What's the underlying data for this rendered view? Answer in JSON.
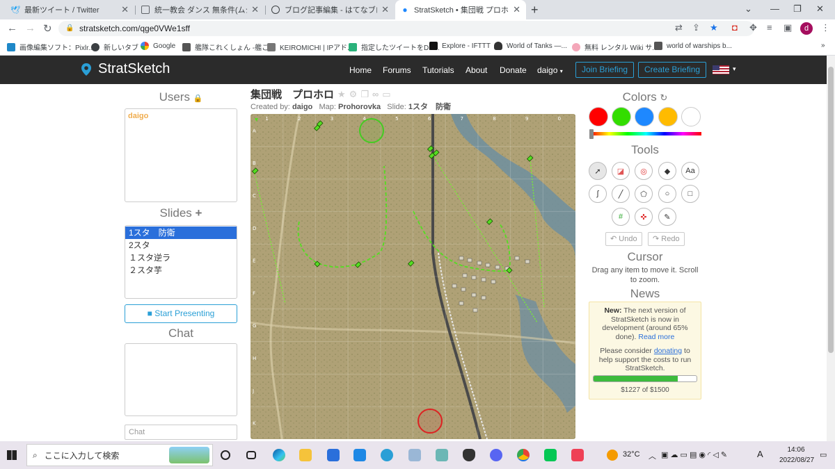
{
  "browser": {
    "tabs": [
      {
        "title": "最新ツイート / Twitter",
        "icon": "twitter-icon"
      },
      {
        "title": "統一教会 ダンス 無条件(ムジョ",
        "icon": "video-icon"
      },
      {
        "title": "ブログ記事編集 - はてなブログ",
        "icon": "hatena-icon"
      },
      {
        "title": "StratSketch • 集団戦 プロホロ",
        "icon": "stratsketch-pin-icon"
      }
    ],
    "url": "stratsketch.com/qge0VWe1sff",
    "bookmarks": [
      "画像編集ソフト：Pixlr...",
      "新しいタブ",
      "Google",
      "艦隊これくしょん -艦こ...",
      "KEIROMICHI | IPアド...",
      "指定したツイートをDis...",
      "Explore - IFTTT",
      "World of Tanks —...",
      "無料 レンタル Wiki サ...",
      "world of warships b..."
    ],
    "profile_initial": "d"
  },
  "site": {
    "brand": "StratSketch",
    "nav": [
      "Home",
      "Forums",
      "Tutorials",
      "About",
      "Donate"
    ],
    "user_menu": "daigo",
    "join_briefing": "Join Briefing",
    "create_briefing": "Create Briefing"
  },
  "users": {
    "heading": "Users",
    "list": [
      "daigo"
    ]
  },
  "slides": {
    "heading": "Slides",
    "items": [
      "1スタ　防衛",
      "2スタ",
      "１スタ逆ラ",
      "２スタ芋"
    ],
    "active_index": 0,
    "present_button": "Start Presenting"
  },
  "chat": {
    "heading": "Chat",
    "placeholder": "Chat"
  },
  "briefing": {
    "title": "集団戦　プロホロ",
    "created_by_label": "Created by:",
    "created_by": "daigo",
    "map_label": "Map:",
    "map": "Prohorovka",
    "slide_label": "Slide:",
    "slide": "1スタ　防衛"
  },
  "map": {
    "columns": [
      "1",
      "2",
      "3",
      "4",
      "5",
      "6",
      "7",
      "8",
      "9",
      "0"
    ],
    "rows": [
      "A",
      "B",
      "C",
      "D",
      "E",
      "F",
      "G",
      "H",
      "J",
      "K"
    ]
  },
  "colors": {
    "heading": "Colors",
    "swatches": [
      "#ff0000",
      "#33dd00",
      "#1e88ff",
      "#ffbb00",
      "#ffffff"
    ]
  },
  "tools": {
    "heading": "Tools",
    "items": [
      "cursor-tool",
      "eraser-tool",
      "ping-tool",
      "tank-marker-tool",
      "text-tool",
      "freehand-tool",
      "line-tool",
      "polygon-tool",
      "circle-tool",
      "square-tool",
      "grid-tool",
      "target-tool",
      "ruler-tool"
    ],
    "text_tool_label": "Aa",
    "undo": "Undo",
    "redo": "Redo"
  },
  "cursor": {
    "heading": "Cursor",
    "text": "Drag any item to move it. Scroll to zoom."
  },
  "news": {
    "heading": "News",
    "new_label": "New:",
    "body": "The next version of StratSketch is now in development (around 65% done).",
    "read_more": "Read more",
    "donate_pre": "Please consider",
    "donate_link": "donating",
    "donate_post": "to help support the costs to run StratSketch.",
    "raised_text": "$1227 of $1500",
    "raised": 1227,
    "goal": 1500
  },
  "taskbar": {
    "search_placeholder": "ここに入力して検索",
    "temperature": "32°C",
    "ime": "A",
    "time": "14:06",
    "date": "2022/08/27"
  }
}
